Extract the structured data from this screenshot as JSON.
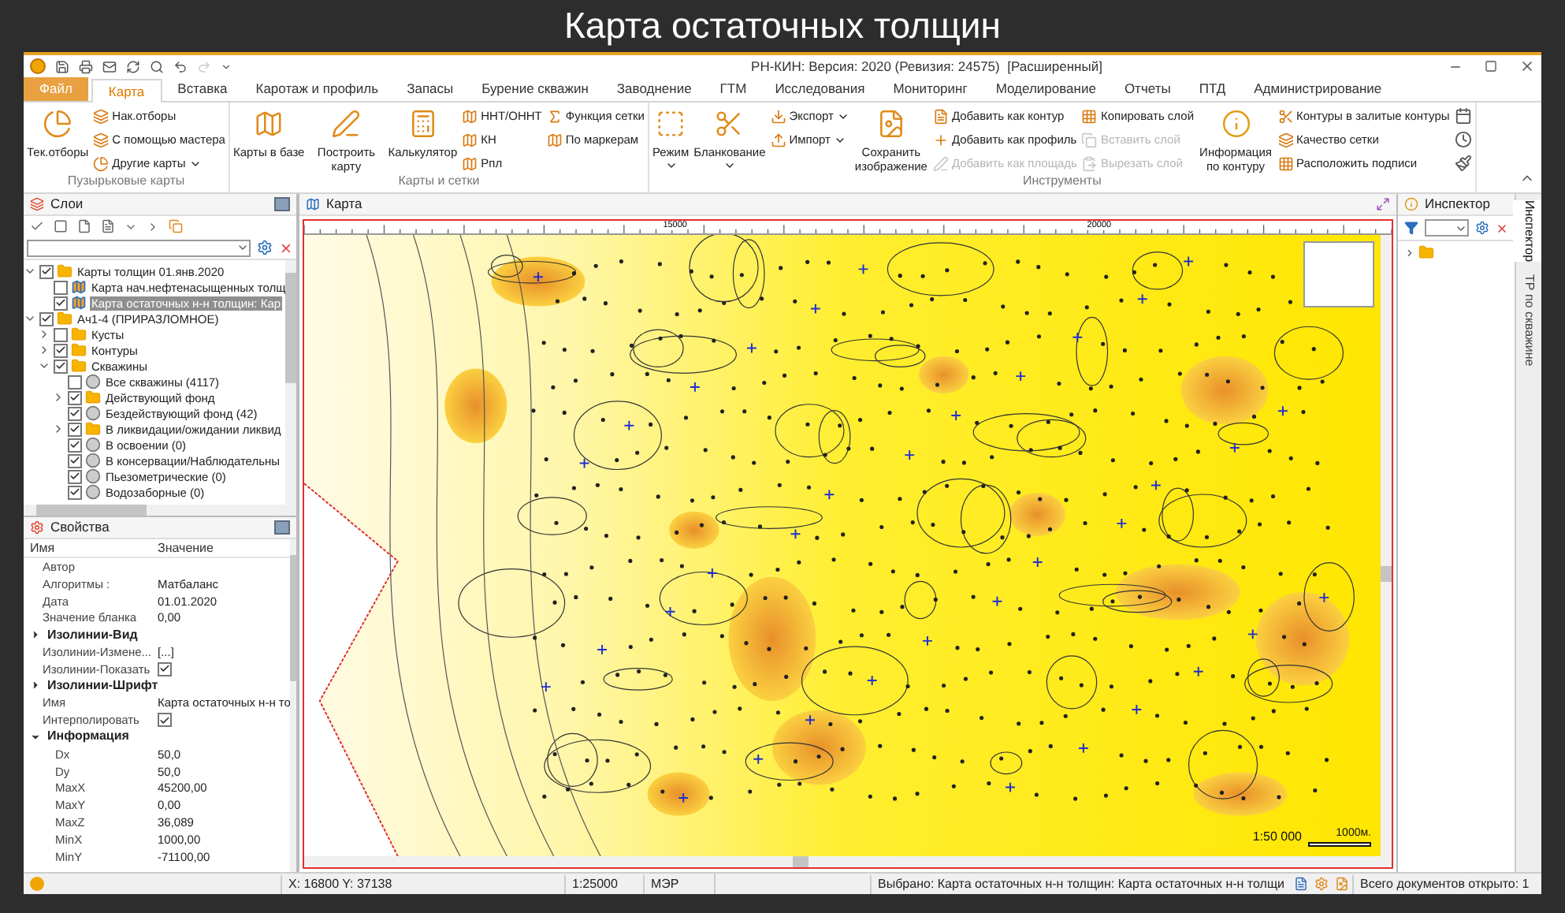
{
  "page_title": "Карта остаточных толщин",
  "window": {
    "title": "РН-КИН: Версия: 2020 (Ревизия: 24575)  [Расширенный]"
  },
  "tabs": [
    {
      "label": "Файл",
      "kind": "file",
      "selected": false
    },
    {
      "label": "Карта",
      "kind": "tab",
      "selected": true
    },
    {
      "label": "Вставка",
      "kind": "tab",
      "selected": false
    },
    {
      "label": "Каротаж и профиль",
      "kind": "tab",
      "selected": false
    },
    {
      "label": "Запасы",
      "kind": "tab",
      "selected": false
    },
    {
      "label": "Бурение скважин",
      "kind": "tab",
      "selected": false
    },
    {
      "label": "Заводнение",
      "kind": "tab",
      "selected": false
    },
    {
      "label": "ГТМ",
      "kind": "tab",
      "selected": false
    },
    {
      "label": "Исследования",
      "kind": "tab",
      "selected": false
    },
    {
      "label": "Мониторинг",
      "kind": "tab",
      "selected": false
    },
    {
      "label": "Моделирование",
      "kind": "tab",
      "selected": false
    },
    {
      "label": "Отчеты",
      "kind": "tab",
      "selected": false
    },
    {
      "label": "ПТД",
      "kind": "tab",
      "selected": false
    },
    {
      "label": "Администрирование",
      "kind": "tab",
      "selected": false
    }
  ],
  "ribbon_groups": [
    {
      "label": "Пузырьковые карты",
      "columns": [
        [
          {
            "label": "Тек.отборы",
            "kind": "large",
            "disabled": false,
            "dropdown": false
          }
        ],
        [
          {
            "label": "Нак.отборы",
            "kind": "small",
            "disabled": false,
            "dropdown": false
          },
          {
            "label": "С помощью мастера",
            "kind": "small",
            "disabled": false,
            "dropdown": false
          },
          {
            "label": "Другие карты",
            "kind": "small",
            "disabled": false,
            "dropdown": true
          }
        ]
      ]
    },
    {
      "label": "Карты и сетки",
      "columns": [
        [
          {
            "label": "Карты в базе",
            "kind": "large",
            "disabled": false,
            "dropdown": false
          }
        ],
        [
          {
            "label": "Построить карту",
            "kind": "large",
            "disabled": false,
            "dropdown": false
          }
        ],
        [
          {
            "label": "Калькулятор",
            "kind": "large",
            "disabled": false,
            "dropdown": false
          }
        ],
        [
          {
            "label": "ННТ/ОННТ",
            "kind": "small",
            "disabled": false,
            "dropdown": false
          },
          {
            "label": "КН",
            "kind": "small",
            "disabled": false,
            "dropdown": false
          },
          {
            "label": "Рпл",
            "kind": "small",
            "disabled": false,
            "dropdown": false
          }
        ],
        [
          {
            "label": "Функция сетки",
            "kind": "small",
            "disabled": false,
            "dropdown": false
          },
          {
            "label": "По маркерам",
            "kind": "small",
            "disabled": false,
            "dropdown": false
          }
        ]
      ]
    },
    {
      "label": "Инструменты",
      "columns": [
        [
          {
            "label": "Режим",
            "kind": "large",
            "disabled": false,
            "dropdown": true
          }
        ],
        [
          {
            "label": "Бланкование",
            "kind": "large",
            "disabled": false,
            "dropdown": true
          }
        ],
        [
          {
            "label": "Экспорт",
            "kind": "small",
            "disabled": false,
            "dropdown": true
          },
          {
            "label": "Импорт",
            "kind": "small",
            "disabled": false,
            "dropdown": true
          }
        ],
        [
          {
            "label": "Сохранить изображение",
            "kind": "large",
            "disabled": false,
            "dropdown": false
          }
        ],
        [
          {
            "label": "Добавить как контур",
            "kind": "small",
            "disabled": false,
            "dropdown": false
          },
          {
            "label": "Добавить как профиль",
            "kind": "small",
            "disabled": false,
            "dropdown": false
          },
          {
            "label": "Добавить как площадь",
            "kind": "small",
            "disabled": true,
            "dropdown": false
          }
        ],
        [
          {
            "label": "Копировать слой",
            "kind": "small",
            "disabled": false,
            "dropdown": false
          },
          {
            "label": "Вставить слой",
            "kind": "small",
            "disabled": true,
            "dropdown": false
          },
          {
            "label": "Вырезать слой",
            "kind": "small",
            "disabled": true,
            "dropdown": false
          }
        ],
        [
          {
            "label": "Информация по контуру",
            "kind": "large",
            "disabled": false,
            "dropdown": false
          }
        ],
        [
          {
            "label": "Контуры в залитые контуры",
            "kind": "small",
            "disabled": false,
            "dropdown": false
          },
          {
            "label": "Качество сетки",
            "kind": "small",
            "disabled": false,
            "dropdown": false
          },
          {
            "label": "Расположить подписи",
            "kind": "small",
            "disabled": false,
            "dropdown": false
          }
        ],
        [
          {
            "kind": "icon",
            "disabled": false,
            "dropdown": false
          },
          {
            "kind": "icon",
            "disabled": false,
            "dropdown": false
          },
          {
            "kind": "icon",
            "disabled": false,
            "dropdown": false
          }
        ]
      ]
    }
  ],
  "layers_panel": {
    "title": "Слои",
    "tree": [
      {
        "label": "Карты толщин 01.янв.2020",
        "kind": "folder",
        "checked": true,
        "expanded": true,
        "selected": false,
        "children": [
          {
            "label": "Карта нач.нефтенасыщенных толщ",
            "kind": "map",
            "checked": false,
            "selected": false
          },
          {
            "label": "Карта остаточных н-н толщин: Кар",
            "kind": "map",
            "checked": true,
            "selected": true
          }
        ]
      },
      {
        "label": "Ач1-4 (ПРИРАЗЛОМНОЕ)",
        "kind": "folder",
        "checked": true,
        "expanded": true,
        "selected": false,
        "children": [
          {
            "label": "Кусты",
            "kind": "folder",
            "checked": false,
            "expanded": false,
            "selected": false
          },
          {
            "label": "Контуры",
            "kind": "folder",
            "checked": true,
            "expanded": false,
            "selected": false
          },
          {
            "label": "Скважины",
            "kind": "folder",
            "checked": true,
            "expanded": true,
            "selected": false,
            "children": [
              {
                "label": "Все скважины (4117)",
                "kind": "wells",
                "checked": false,
                "selected": false
              },
              {
                "label": "Действующий фонд",
                "kind": "folder",
                "checked": true,
                "expanded": false,
                "selected": false
              },
              {
                "label": "Бездействующий фонд (42)",
                "kind": "wells",
                "checked": true,
                "selected": false
              },
              {
                "label": "В ликвидации/ожидании ликвид",
                "kind": "folder",
                "checked": true,
                "expanded": false,
                "selected": false
              },
              {
                "label": "В освоении (0)",
                "kind": "wells",
                "checked": true,
                "selected": false
              },
              {
                "label": "В консервации/Наблюдательны",
                "kind": "wells",
                "checked": true,
                "selected": false
              },
              {
                "label": "Пьезометрические (0)",
                "kind": "wells",
                "checked": true,
                "selected": false
              },
              {
                "label": "Водозаборные (0)",
                "kind": "wells",
                "checked": true,
                "selected": false
              }
            ]
          }
        ]
      }
    ]
  },
  "properties_panel": {
    "title": "Свойства",
    "columns": [
      "Имя",
      "Значение"
    ],
    "rows": [
      {
        "kind": "row",
        "name": "Автор",
        "value": ""
      },
      {
        "kind": "row",
        "name": "Алгоритмы :",
        "value": "Матбаланс"
      },
      {
        "kind": "row",
        "name": "Дата",
        "value": "01.01.2020"
      },
      {
        "kind": "row",
        "name": "Значение бланка",
        "value": "0,00"
      },
      {
        "kind": "category",
        "name": "Изолинии-Вид",
        "expanded": false
      },
      {
        "kind": "row",
        "name": "Изолинии-Измене...",
        "value": "[...]"
      },
      {
        "kind": "check",
        "name": "Изолинии-Показать",
        "checked": true
      },
      {
        "kind": "category",
        "name": "Изолинии-Шрифт",
        "expanded": false
      },
      {
        "kind": "row",
        "name": "Имя",
        "value": "Карта остаточных н-н то"
      },
      {
        "kind": "check",
        "name": "Интерполировать",
        "checked": true
      },
      {
        "kind": "category",
        "name": "Информация",
        "expanded": true
      },
      {
        "kind": "sub",
        "name": "Dx",
        "value": "50,0"
      },
      {
        "kind": "sub",
        "name": "Dy",
        "value": "50,0"
      },
      {
        "kind": "sub",
        "name": "MaxX",
        "value": "45200,00"
      },
      {
        "kind": "sub",
        "name": "MaxY",
        "value": "0,00"
      },
      {
        "kind": "sub",
        "name": "MaxZ",
        "value": "36,089"
      },
      {
        "kind": "sub",
        "name": "MinX",
        "value": "1000,00"
      },
      {
        "kind": "sub",
        "name": "MinY",
        "value": "-71100,00"
      }
    ]
  },
  "map_panel": {
    "title": "Карта",
    "ruler_labels": [
      "15000",
      "20000"
    ],
    "scale": "1:50 000",
    "scale_bar_label": "1000м."
  },
  "inspector": {
    "title": "Инспектор",
    "side_tabs": [
      {
        "label": "Инспектор",
        "selected": true
      },
      {
        "label": "ТР по скважине",
        "selected": false
      }
    ]
  },
  "status_bar": {
    "coordinates": "X: 16800 Y: 37138",
    "scale": "1:25000",
    "source": "МЭР",
    "selection": "Выбрано: Карта остаточных н-н толщин: Карта остаточных н-н толщи",
    "documents": "Всего документов открыто: 1"
  }
}
